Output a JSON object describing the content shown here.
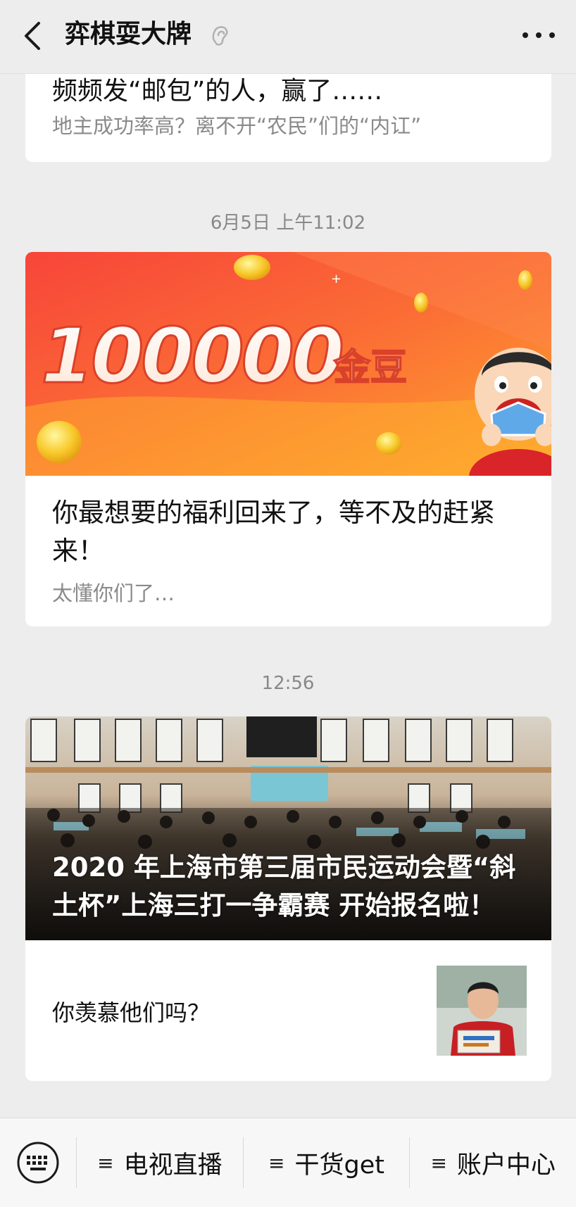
{
  "header": {
    "title": "弈棋耍大牌",
    "back_icon": "chevron-left-icon",
    "ear_icon": "ear-icon",
    "more_icon": "more-dots-icon"
  },
  "messages": [
    {
      "title": "频频发“邮包”的人，赢了……",
      "summary": "地主成功率高？离不开“农民”们的“内讧”"
    },
    {
      "timestamp": "6月5日 上午11:02",
      "banner_text": "100000",
      "banner_suffix": "金豆",
      "title": "你最想要的福利回来了，等不及的赶紧来！",
      "summary": "太懂你们了…"
    },
    {
      "timestamp": "12:56",
      "title": "2020 年上海市第三届市民运动会暨“斜土杯”上海三打一争霸赛 开始报名啦！",
      "sub_title": "你羡慕他们吗？"
    }
  ],
  "bottom_menu": {
    "keyboard_icon": "keyboard-icon",
    "items": [
      {
        "label": "电视直播",
        "icon": "menu-icon"
      },
      {
        "label": "干货get",
        "icon": "menu-icon"
      },
      {
        "label": "账户中心",
        "icon": "menu-icon"
      }
    ]
  }
}
